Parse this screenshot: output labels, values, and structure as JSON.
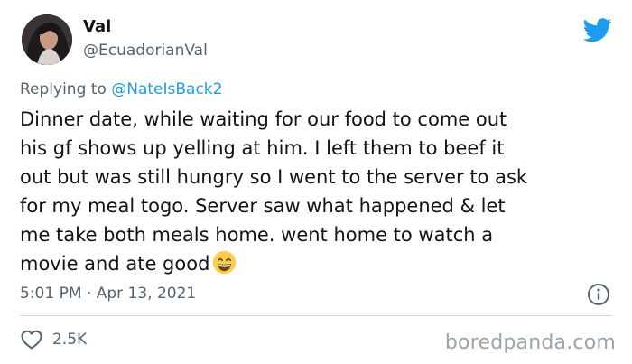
{
  "author": {
    "display_name": "Val",
    "handle": "@EcuadorianVal"
  },
  "reply": {
    "prefix": "Replying to",
    "mention": "@NateIsBack2"
  },
  "tweet": {
    "lines": [
      "Dinner date, while waiting for our food to come out",
      "his gf shows up yelling at him. I left them to beef it",
      "out but was still hungry so I went to the server to ask",
      "for my meal togo. Server saw what happened & let",
      "me take both meals home. went home to watch a",
      "movie and ate good"
    ],
    "emoji": "grinning-face-with-smiling-eyes-emoji"
  },
  "meta": {
    "timestamp": "5:01 PM · Apr 13, 2021"
  },
  "actions": {
    "like_count": "2.5K"
  },
  "watermark": "boredpanda.com",
  "colors": {
    "accent": "#1d9bf0",
    "text": "#0f1419",
    "secondary": "#536471",
    "divider": "#cfd9de"
  },
  "icons": [
    "twitter-bird-icon",
    "info-icon",
    "heart-icon"
  ]
}
